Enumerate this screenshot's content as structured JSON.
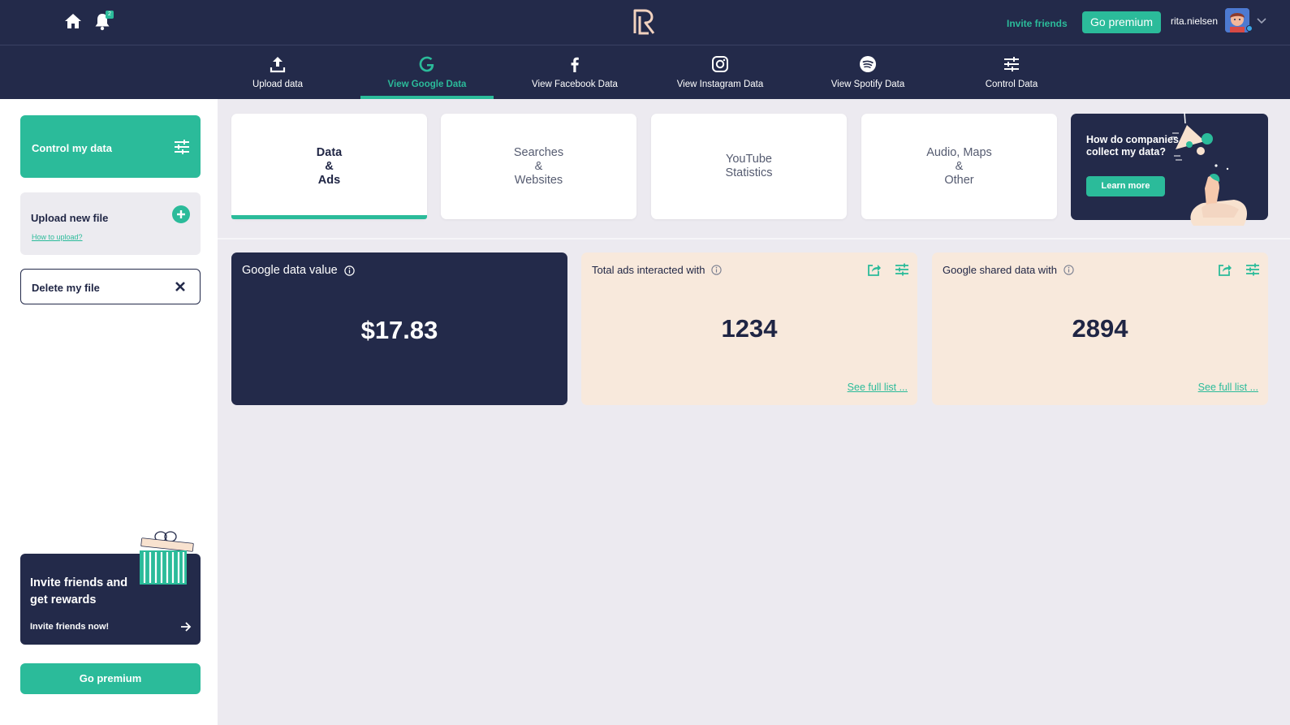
{
  "header": {
    "notification_count": "2",
    "invite_label": "Invite friends",
    "premium_label": "Go premium",
    "username": "rita.nielsen"
  },
  "nav": {
    "items": [
      {
        "label": "Upload data",
        "icon": "upload-icon"
      },
      {
        "label": "View Google Data",
        "icon": "google-icon",
        "active": true
      },
      {
        "label": "View Facebook Data",
        "icon": "facebook-icon"
      },
      {
        "label": "View Instagram Data",
        "icon": "instagram-icon"
      },
      {
        "label": "View Spotify Data",
        "icon": "spotify-icon"
      },
      {
        "label": "Control Data",
        "icon": "sliders-icon"
      }
    ]
  },
  "sidebar": {
    "control_label": "Control my data",
    "upload_label": "Upload new file",
    "upload_help": "How to upload?",
    "delete_label": "Delete my file",
    "invite_title": "Invite friends and get rewards",
    "invite_cta": "Invite friends now!",
    "premium_label": "Go premium"
  },
  "categories": [
    {
      "label": "Data\n&\nAds",
      "active": true
    },
    {
      "label": "Searches\n&\nWebsites"
    },
    {
      "label": "YouTube\nStatistics"
    },
    {
      "label": "Audio, Maps\n&\nOther"
    }
  ],
  "promo": {
    "title": "How do companies collect my data?",
    "button": "Learn more"
  },
  "cards": [
    {
      "title": "Google data value",
      "value": "$17.83",
      "style": "dark"
    },
    {
      "title": "Total ads interacted with",
      "value": "1234",
      "link": "See full list ...",
      "style": "peach"
    },
    {
      "title": "Google shared data with",
      "value": "2894",
      "link": "See full list ...",
      "style": "peach"
    }
  ],
  "colors": {
    "accent": "#2bbb9a",
    "navy": "#232a4a",
    "peach": "#f8e9dc",
    "background": "#eceaf0"
  }
}
